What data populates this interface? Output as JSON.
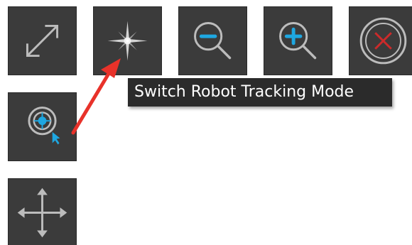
{
  "tooltip": {
    "text": "Switch Robot Tracking Mode"
  },
  "colors": {
    "button_background": "#3b3b3b",
    "icon_gray": "#bcbcbc",
    "accent_blue": "#1ea7e1",
    "close_red": "#cc2a2a",
    "tooltip_background": "#2b2b2b",
    "arrow_red": "#e8322a"
  },
  "toolbar": {
    "buttons": [
      {
        "name": "expand",
        "icon": "expand-arrows-icon"
      },
      {
        "name": "robot-tracking",
        "icon": "compass-star-icon"
      },
      {
        "name": "zoom-out",
        "icon": "zoom-out-icon"
      },
      {
        "name": "zoom-in",
        "icon": "zoom-in-icon"
      },
      {
        "name": "close",
        "icon": "close-circle-icon"
      },
      {
        "name": "target",
        "icon": "target-cursor-icon"
      },
      {
        "name": "pan",
        "icon": "move-arrows-icon"
      }
    ]
  }
}
